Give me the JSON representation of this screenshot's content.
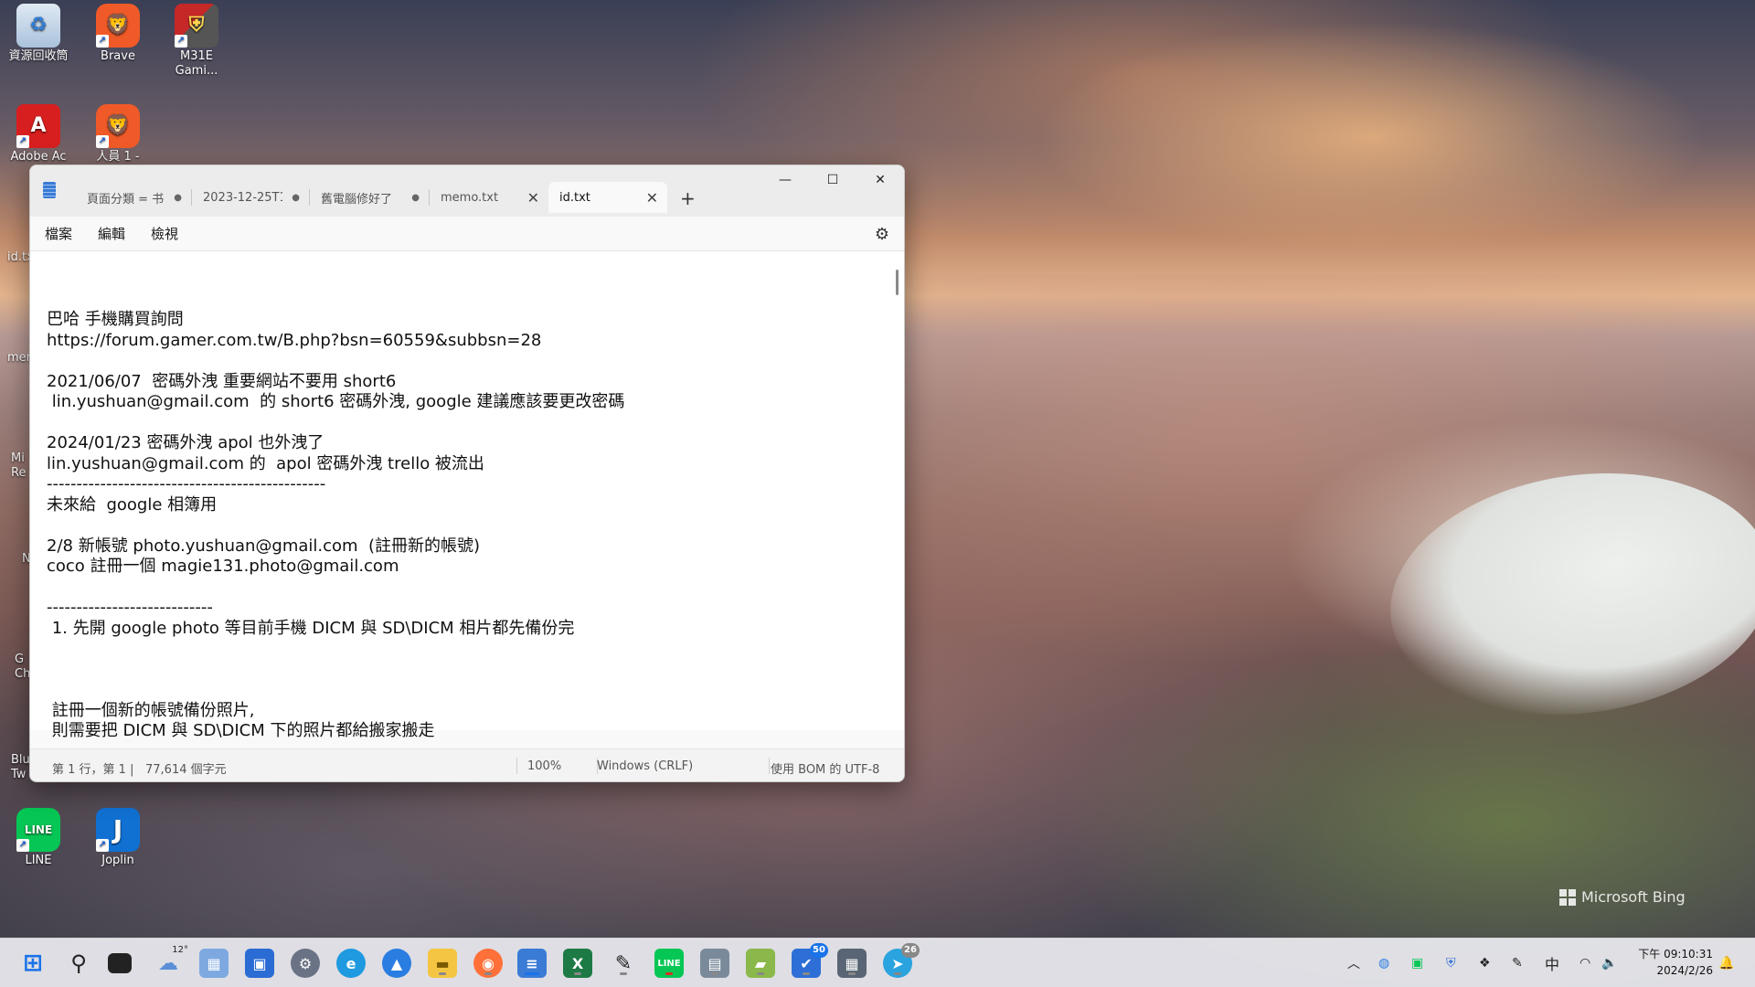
{
  "desktop": {
    "icons": [
      {
        "label": "資源回收筒"
      },
      {
        "label": "Brave"
      },
      {
        "label": "M31E Gami..."
      },
      {
        "label": "Adobe Ac"
      },
      {
        "label": "人員 1 -"
      },
      {
        "label": "LINE"
      },
      {
        "label": "Joplin"
      }
    ],
    "partial_labels": [
      "id.tx",
      "mer",
      "Mi Re",
      "N",
      "G Ch",
      "Blu Tw"
    ],
    "watermark": "Microsoft Bing"
  },
  "notepad": {
    "tabs": [
      {
        "label": "頁面分類 = 书",
        "modified": "●"
      },
      {
        "label": "2023-12-25T1",
        "modified": "●"
      },
      {
        "label": "舊電腦修好了",
        "modified": "●"
      },
      {
        "label": "memo.txt",
        "close": "✕"
      },
      {
        "label": "id.txt",
        "close": "✕"
      }
    ],
    "new_tab": "+",
    "window_controls": {
      "minimize": "—",
      "maximize": "☐",
      "close": "✕"
    },
    "menu": {
      "file": "檔案",
      "edit": "編輯",
      "view": "檢視"
    },
    "content": "巴哈 手機購買詢問\nhttps://forum.gamer.com.tw/B.php?bsn=60559&subbsn=28\n\n2021/06/07  密碼外洩 重要網站不要用 short6\n lin.yushuan@gmail.com  的 short6 密碼外洩, google 建議應該要更改密碼\n\n2024/01/23 密碼外洩 apol 也外洩了\nlin.yushuan@gmail.com 的  apol 密碼外洩 trello 被流出\n-----------------------------------------------\n未來給  google 相簿用\n\n2/8 新帳號 photo.yushuan@gmail.com  (註冊新的帳號)\ncoco 註冊一個 magie131.photo@gmail.com\n\n----------------------------\n 1. 先開 google photo 等目前手機 DICM 與 SD\\DICM 相片都先備份完\n\n\n\n 註冊一個新的帳號備份照片,\n 則需要把 DICM 與 SD\\DICM 下的照片都給搬家搬走",
    "status": {
      "position": "第 1 行，第 1 |",
      "chars": "77,614 個字元",
      "zoom": "100%",
      "line_ending": "Windows (CRLF)",
      "encoding": "使用 BOM 的 UTF-8"
    }
  },
  "taskbar": {
    "weather_temp": "12°",
    "badge_todo": "50",
    "badge_telegram": "26",
    "tray_ime": "中",
    "clock_time": "下午 09:10:31",
    "clock_date": "2024/2/26"
  },
  "colors": {
    "accent": "#1a73e8",
    "window_bg": "#f9f9f9",
    "taskbar_bg": "#ebebf0"
  }
}
